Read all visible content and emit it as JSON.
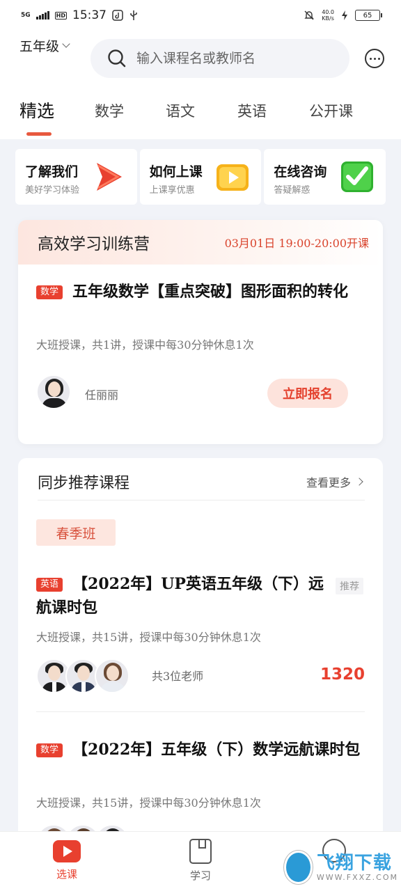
{
  "status_bar": {
    "network": "5G",
    "hd": "HD",
    "time": "15:37",
    "speed_value": "40.0",
    "speed_unit": "KB/s",
    "battery": "65"
  },
  "header": {
    "grade": "五年级",
    "search_placeholder": "输入课程名或教师名",
    "tabs": [
      "精选",
      "数学",
      "语文",
      "英语",
      "公开课"
    ]
  },
  "quick_links": [
    {
      "title": "了解我们",
      "subtitle": "美好学习体验",
      "icon": "red-play-logo-icon"
    },
    {
      "title": "如何上课",
      "subtitle": "上课享优惠",
      "icon": "yellow-video-icon"
    },
    {
      "title": "在线咨询",
      "subtitle": "答疑解惑",
      "icon": "green-check-icon"
    }
  ],
  "camp": {
    "title": "高效学习训练营",
    "time": "03月01日 19:00-20:00开课",
    "course": {
      "tag": "数学",
      "title": "五年级数学【重点突破】图形面积的转化",
      "desc": "大班授课，共1讲，授课中每30分钟休息1次",
      "teacher": "任丽丽",
      "enroll_label": "立即报名"
    }
  },
  "recommend": {
    "title": "同步推荐课程",
    "more_label": "查看更多",
    "season": "春季班",
    "courses": [
      {
        "tag": "英语",
        "title": "【2022年】UP英语五年级（下）远航课时包",
        "desc": "大班授课，共15讲，授课中每30分钟休息1次",
        "teachers_label": "共3位老师",
        "badge": "推荐",
        "price": "1320"
      },
      {
        "tag": "数学",
        "title": "【2022年】五年级（下）数学远航课时包",
        "desc": "大班授课，共15讲，授课中每30分钟休息1次"
      }
    ]
  },
  "bottom_nav": [
    {
      "label": "选课",
      "icon": "play-icon"
    },
    {
      "label": "学习",
      "icon": "book-icon"
    },
    {
      "label": "",
      "icon": "profile-icon"
    }
  ],
  "watermark": {
    "main": "飞翔下载",
    "sub": "WWW.FXXZ.COM"
  },
  "colors": {
    "accent": "#e8402f",
    "tab_indicator": "#e8593f",
    "background": "#f1f3f8"
  }
}
